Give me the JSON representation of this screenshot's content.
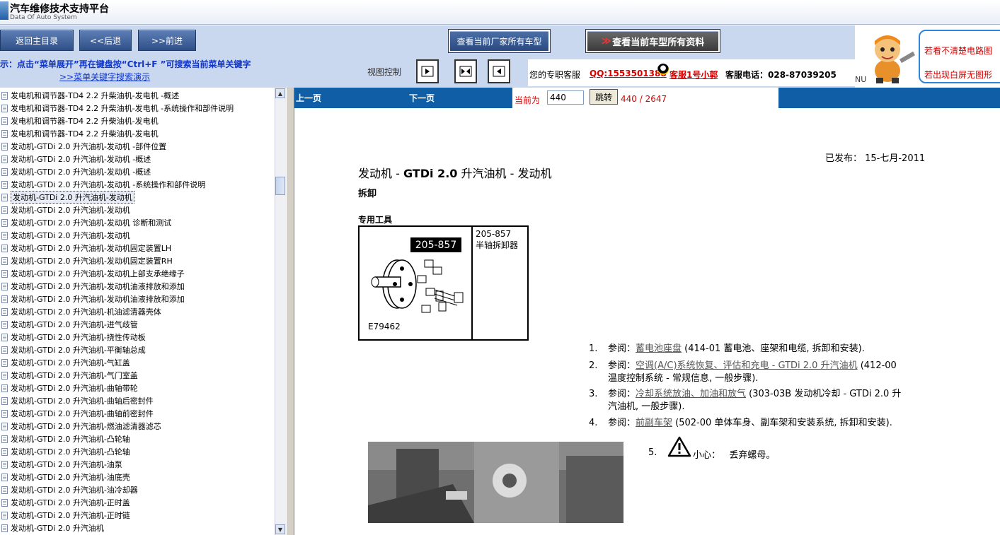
{
  "app": {
    "title": "汽车维修技术支持平台",
    "subtitle": "Data Of Auto System"
  },
  "nav": {
    "home": "返回主目录",
    "back": "<<后退",
    "forward": ">>前进",
    "all_models": "查看当前厂家所有车型",
    "all_info_arrow": "≫",
    "all_info": "查看当前车型所有资料"
  },
  "hint": {
    "text": "示：点击“菜单展开”再在键盘按“Ctrl+F ”可搜索当前菜单关键字",
    "link": ">>菜单关键字搜索演示"
  },
  "view_control": {
    "label": "视图控制"
  },
  "contact": {
    "prefix": "您的专职客服",
    "qq": "QQ:1553501388",
    "agent": "客服1号小郭",
    "phone": "客服电话：028-87039205"
  },
  "banner": {
    "line1": "若看不清楚电路图",
    "line2": "若出现白屏无图形",
    "nu": "NU"
  },
  "tree": {
    "items": [
      "发电机和调节器-TD4 2.2 升柴油机-发电机  -概述",
      "发电机和调节器-TD4 2.2 升柴油机-发电机  -系统操作和部件说明",
      "发电机和调节器-TD4 2.2 升柴油机-发电机",
      "发电机和调节器-TD4 2.2 升柴油机-发电机",
      "发动机-GTDi 2.0 升汽油机-发动机  -部件位置",
      "发动机-GTDi 2.0 升汽油机-发动机  -概述",
      "发动机-GTDi 2.0 升汽油机-发动机  -概述",
      "发动机-GTDi 2.0 升汽油机-发动机  -系统操作和部件说明",
      "发动机-GTDi 2.0 升汽油机-发动机",
      "发动机-GTDi 2.0 升汽油机-发动机",
      "发动机-GTDi 2.0 升汽油机-发动机  诊断和测试",
      "发动机-GTDi 2.0 升汽油机-发动机",
      "发动机-GTDi 2.0 升汽油机-发动机固定装置LH",
      "发动机-GTDi 2.0 升汽油机-发动机固定装置RH",
      "发动机-GTDi 2.0 升汽油机-发动机上部支承绝缘子",
      "发动机-GTDi 2.0 升汽油机-发动机油液排放和添加",
      "发动机-GTDi 2.0 升汽油机-发动机油液排放和添加",
      "发动机-GTDi 2.0 升汽油机-机油滤清器壳体",
      "发动机-GTDi 2.0 升汽油机-进气歧管",
      "发动机-GTDi 2.0 升汽油机-挠性传动板",
      "发动机-GTDi 2.0 升汽油机-平衡轴总成",
      "发动机-GTDi 2.0 升汽油机-气缸盖",
      "发动机-GTDi 2.0 升汽油机-气门室盖",
      "发动机-GTDi 2.0 升汽油机-曲轴带轮",
      "发动机-GTDi 2.0 升汽油机-曲轴后密封件",
      "发动机-GTDi 2.0 升汽油机-曲轴前密封件",
      "发动机-GTDi 2.0 升汽油机-燃油滤清器滤芯",
      "发动机-GTDi 2.0 升汽油机-凸轮轴",
      "发动机-GTDi 2.0 升汽油机-凸轮轴",
      "发动机-GTDi 2.0 升汽油机-油泵",
      "发动机-GTDi 2.0 升汽油机-油底壳",
      "发动机-GTDi 2.0 升汽油机-油冷却器",
      "发动机-GTDi 2.0 升汽油机-正时盖",
      "发动机-GTDi 2.0 升汽油机-正时链",
      "发动机-GTDi 2.0 升汽油机"
    ],
    "selected_index": 8
  },
  "pager": {
    "prev": "上一页",
    "next": "下一页",
    "current_label": "当前为",
    "current_value": "440",
    "jump": "跳转",
    "count": "440 / 2647"
  },
  "doc": {
    "published": "已发布：  15-七月-2011",
    "title_pre": "发动机  - ",
    "title_bold": "GTDi 2.0",
    "title_post": " 升汽油机  - 发动机",
    "subtitle": "拆卸",
    "tools_heading": "专用工具",
    "tool_tag": "205-857",
    "tool_code": "E79462",
    "tool_number": "205-857",
    "tool_name": "半轴拆卸器",
    "steps": [
      {
        "num": "1.",
        "pre": "参阅：",
        "link": "蓄电池座盘",
        "post": " (414-01 蓄电池、座架和电缆, 拆卸和安装).",
        "line2": ""
      },
      {
        "num": "2.",
        "pre": "参阅：",
        "link": "空调(A/C)系统恢复、评估和充电  - GTDi 2.0 升汽油机",
        "post": " (412-00",
        "line2": "温度控制系统  - 常规信息, 一般步骤)."
      },
      {
        "num": "3.",
        "pre": "参阅：",
        "link": "冷却系统放油、加油和放气",
        "post": " (303-03B 发动机冷却  - GTDi 2.0 升",
        "line2": "汽油机, 一般步骤)."
      },
      {
        "num": "4.",
        "pre": "参阅：",
        "link": "前副车架",
        "post": " (502-00 单体车身、副车架和安装系统, 拆卸和安装).",
        "line2": ""
      }
    ],
    "step5_num": "5.",
    "step5_caution": "小心：",
    "step5_text": "丢弃螺母。"
  }
}
